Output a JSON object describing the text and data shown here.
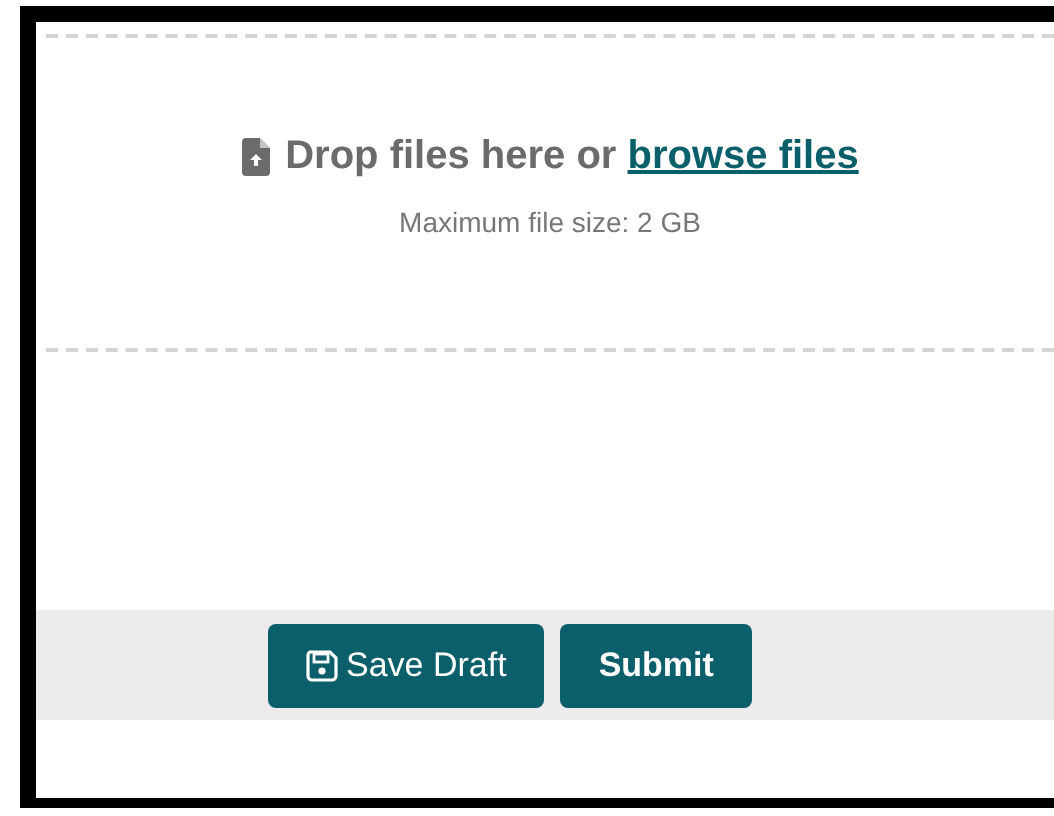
{
  "dropzone": {
    "prompt": "Drop files here or",
    "link": "browse files",
    "note": "Maximum file size: 2 GB"
  },
  "actions": [
    {
      "label": "Save Draft",
      "kind": "save"
    },
    {
      "label": "Submit",
      "kind": "plain"
    }
  ]
}
